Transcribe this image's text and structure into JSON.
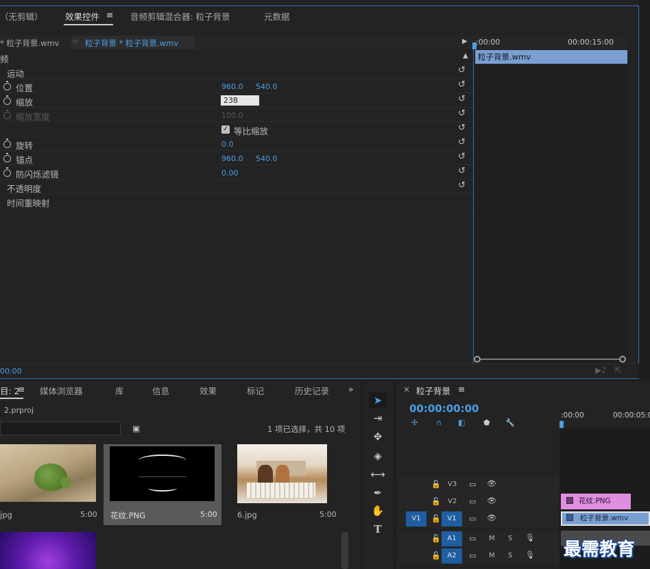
{
  "effect_controls": {
    "tabs": [
      {
        "label": "（无剪辑）"
      },
      {
        "label": "效果控件"
      },
      {
        "label": "≡"
      },
      {
        "label": "音频剪辑混合器: 粒子背景"
      },
      {
        "label": "元数据"
      }
    ],
    "source_clip": "* 粒子背景.wmv",
    "sequence_clip": "粒子背景 * 粒子背景.wmv",
    "header_col": "频",
    "timecode_start": ":00:00",
    "timecode_mid": "00:00:15:00",
    "clip_bar_label": "粒子背景.wmv",
    "bottom_timecode": "00:00",
    "rows": {
      "motion": "运动",
      "position": {
        "label": "位置",
        "x": "960.0",
        "y": "540.0"
      },
      "scale": {
        "label": "缩放",
        "value": "238"
      },
      "scale_width": {
        "label": "缩放宽度",
        "value": "100.0"
      },
      "uniform_scale": "等比缩放",
      "rotation": {
        "label": "旋转",
        "value": "0.0"
      },
      "anchor": {
        "label": "锚点",
        "x": "960.0",
        "y": "540.0"
      },
      "anti_flicker": {
        "label": "防闪烁滤镜",
        "value": "0.00"
      },
      "opacity": "不透明度",
      "time_remap": "时间重映射"
    }
  },
  "project": {
    "tabs": [
      {
        "label": "目: 2"
      },
      {
        "label": "媒体浏览器"
      },
      {
        "label": "库"
      },
      {
        "label": "信息"
      },
      {
        "label": "效果"
      },
      {
        "label": "标记"
      },
      {
        "label": "历史记录"
      }
    ],
    "overflow": "»",
    "project_file": "2.prproj",
    "selection_status": "1 项已选择，共 10 项",
    "items": [
      {
        "name": "jpg",
        "duration": "5:00"
      },
      {
        "name": "花纹.PNG",
        "duration": "5:00"
      },
      {
        "name": "6.jpg",
        "duration": "5:00"
      }
    ]
  },
  "timeline": {
    "title": "粒子背景",
    "close": "×",
    "menu": "≡",
    "timecode": "00:00:00:00",
    "ruler_start": ":00:00",
    "ruler_mid": "00:00:05:00",
    "tracks": [
      {
        "name": "V3"
      },
      {
        "name": "V2"
      },
      {
        "name": "V1",
        "target": "V1"
      },
      {
        "name": "A1"
      },
      {
        "name": "A2"
      }
    ],
    "clips": {
      "v2": "花纹.PNG",
      "v1": "粒子背景.wmv"
    },
    "mute": "M",
    "solo": "S"
  },
  "watermark": "最需教育",
  "colors": {
    "accent_blue": "#4a9fe8",
    "clip_blue": "#7a9fd1",
    "clip_pink": "#e08ee0",
    "panel_bg": "#232323"
  }
}
